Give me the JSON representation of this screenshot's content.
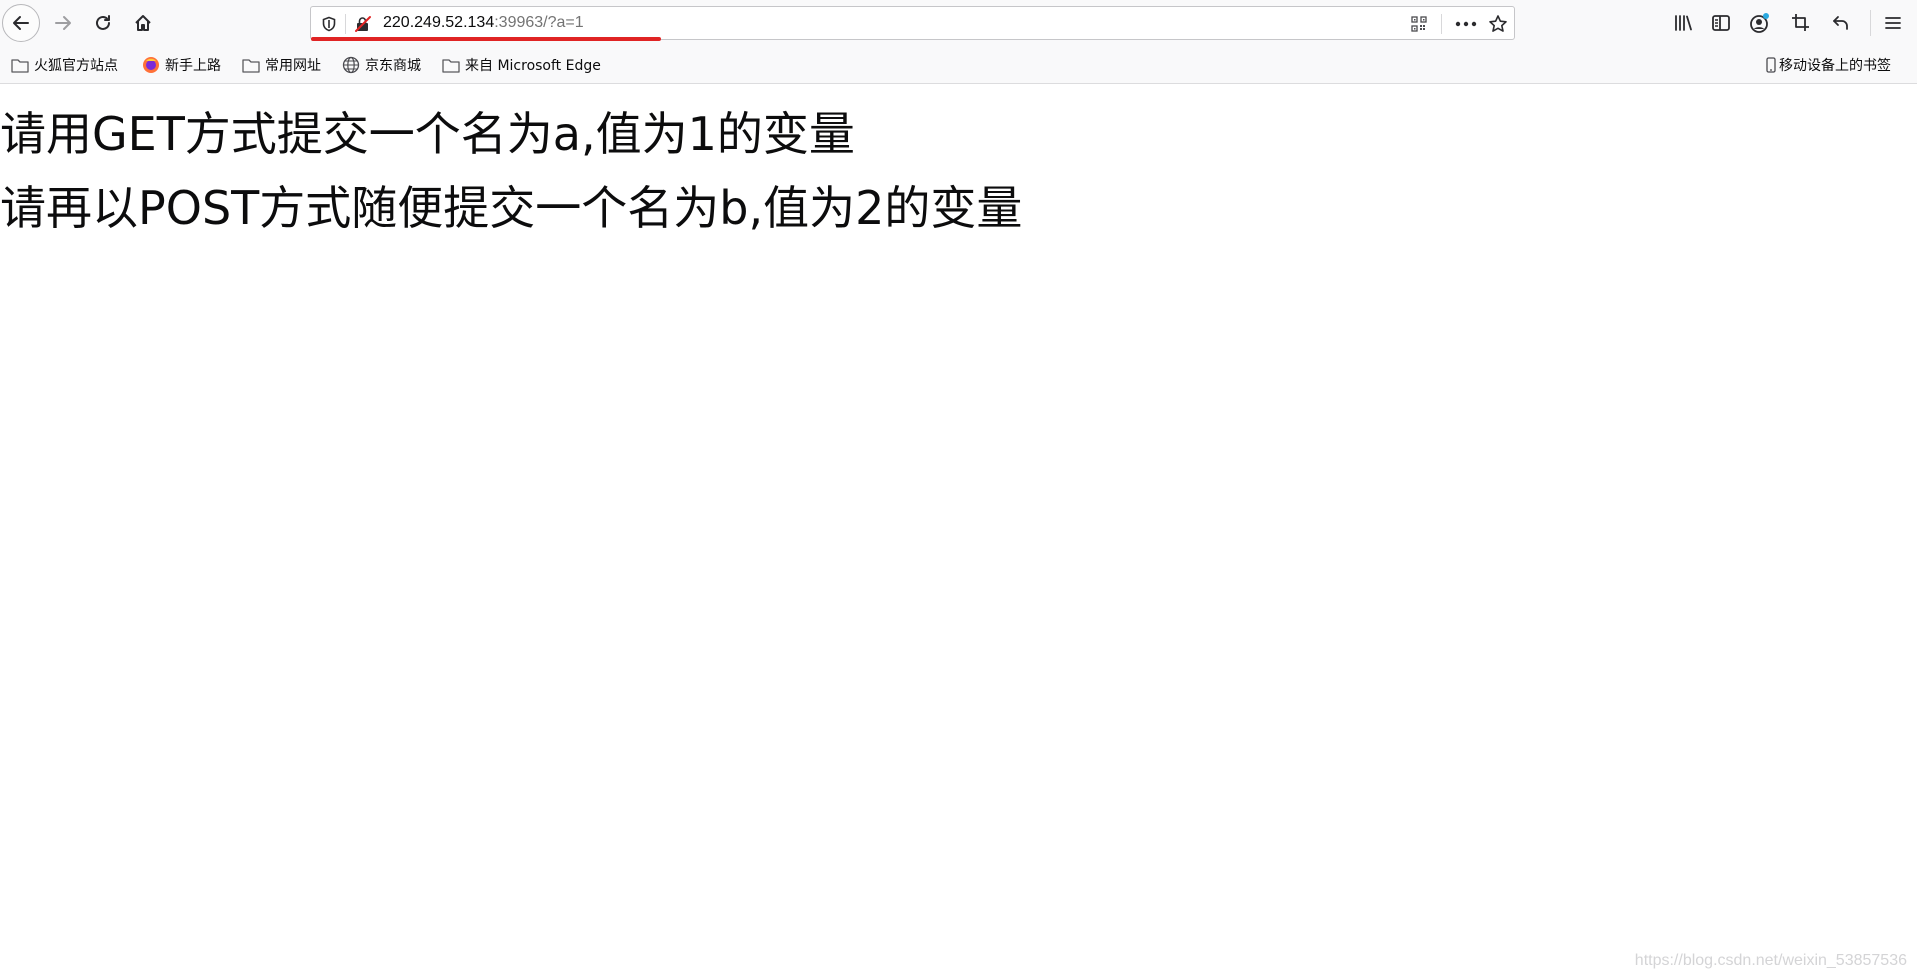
{
  "urlbar": {
    "host": "220.249.52.134",
    "rest": ":39963/?a=1"
  },
  "bookmarks": [
    {
      "label": "火狐官方站点",
      "icon": "folder-icon"
    },
    {
      "label": "新手上路",
      "icon": "firefox-icon"
    },
    {
      "label": "常用网址",
      "icon": "folder-icon"
    },
    {
      "label": "京东商城",
      "icon": "globe-icon"
    },
    {
      "label": "来自 Microsoft Edge",
      "icon": "folder-icon"
    }
  ],
  "mobile_bookmarks": {
    "label": "移动设备上的书签",
    "icon": "mobile-icon"
  },
  "page": {
    "line1": "请用GET方式提交一个名为a,值为1的变量",
    "line2": "请再以POST方式随便提交一个名为b,值为2的变量"
  },
  "watermark": "https://blog.csdn.net/weixin_53857536",
  "colors": {
    "toolbar_bg": "#f9f9fa",
    "url_underline": "#e02424",
    "notification_dot": "#2aa9e0"
  }
}
